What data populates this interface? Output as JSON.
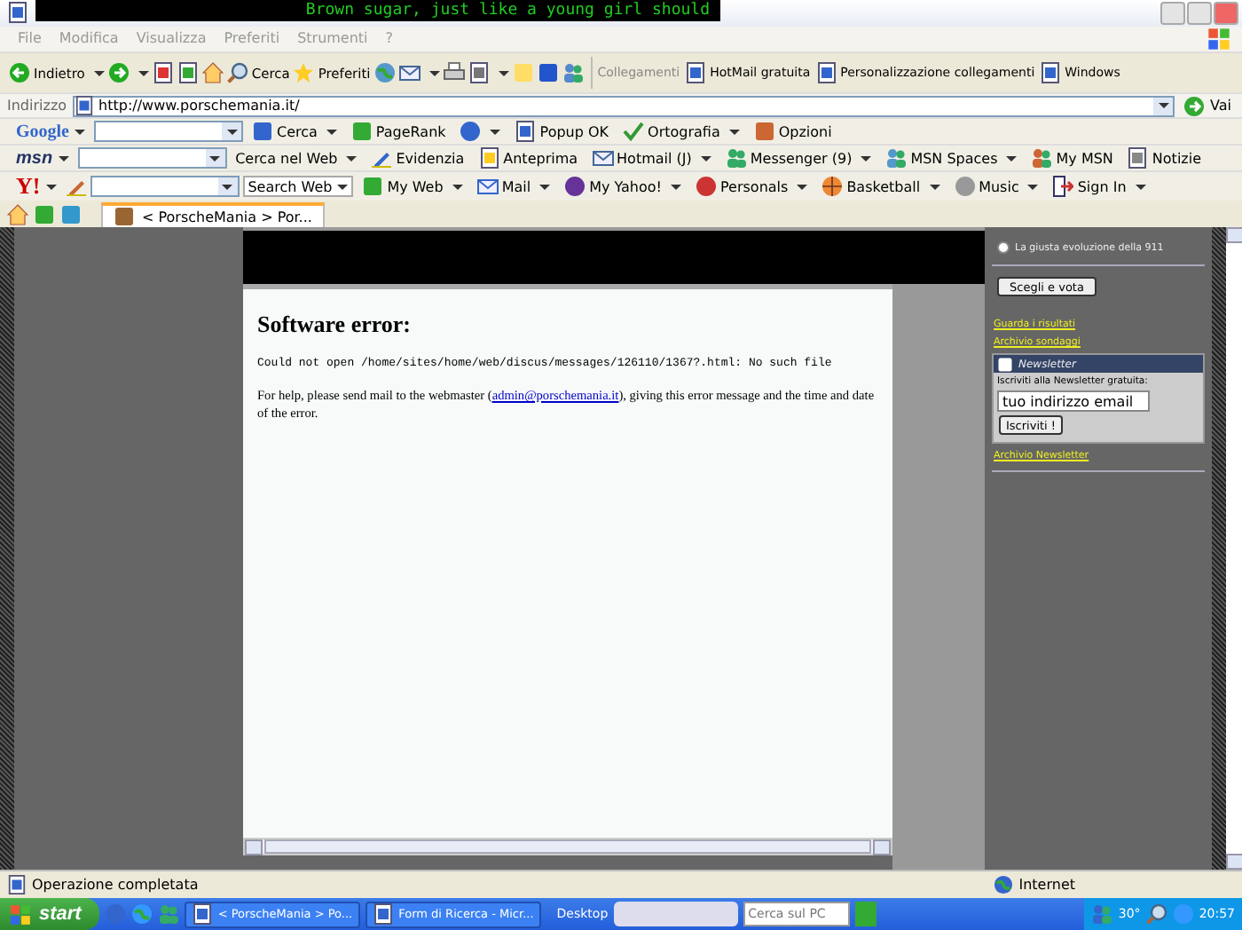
{
  "window": {
    "title": "Brown sugar, just like a young girl should"
  },
  "menu": [
    "File",
    "Modifica",
    "Visualizza",
    "Preferiti",
    "Strumenti",
    "?"
  ],
  "toolbar": [
    {
      "label": "Indietro",
      "dropdown": true
    },
    {
      "dropdown": true
    },
    {
      "dropdown": false
    },
    {
      "dropdown": false
    },
    {
      "dropdown": false
    },
    {
      "label": "Cerca",
      "dropdown": false
    },
    {
      "label": "Preferiti",
      "dropdown": false
    },
    {
      "dropdown": false
    },
    {
      "dropdown": true
    },
    {
      "dropdown": false
    },
    {
      "dropdown": true
    },
    {
      "dropdown": false
    },
    {
      "dropdown": false
    },
    {
      "dropdown": false
    }
  ],
  "links": {
    "label": "Collegamenti",
    "items": [
      "HotMail gratuita",
      "Personalizzazione collegamenti",
      "Windows"
    ]
  },
  "address": {
    "label": "Indirizzo",
    "value": "http://www.porschemania.it/",
    "go": "Vai"
  },
  "google_bar": {
    "logo": "Google",
    "buttons": [
      {
        "label": "Cerca",
        "dropdown": true
      },
      {
        "label": "PageRank",
        "dropdown": false
      },
      {
        "dropdown": true
      },
      {
        "label": "Popup OK",
        "dropdown": false
      },
      {
        "label": "Ortografia",
        "dropdown": true
      },
      {
        "label": "Opzioni",
        "dropdown": false
      }
    ]
  },
  "msn_bar": {
    "logo": "msn",
    "buttons": [
      {
        "label": "Cerca nel Web",
        "dropdown": true
      },
      {
        "label": "Evidenzia",
        "dropdown": false
      },
      {
        "label": "Anteprima",
        "dropdown": false
      },
      {
        "label": "Hotmail (J)",
        "dropdown": true
      },
      {
        "label": "Messenger (9)",
        "dropdown": true
      },
      {
        "label": "MSN Spaces",
        "dropdown": true
      },
      {
        "label": "My MSN",
        "dropdown": false
      },
      {
        "label": "Notizie",
        "dropdown": false
      }
    ]
  },
  "yahoo_bar": {
    "logo": "Y!",
    "search": "Search Web",
    "buttons": [
      {
        "label": "My Web",
        "dropdown": true
      },
      {
        "label": "Mail",
        "dropdown": true
      },
      {
        "label": "My Yahoo!",
        "dropdown": true
      },
      {
        "label": "Personals",
        "dropdown": true
      },
      {
        "label": "Basketball",
        "dropdown": true
      },
      {
        "label": "Music",
        "dropdown": true
      },
      {
        "label": "Sign In",
        "dropdown": true
      }
    ]
  },
  "tabs": [
    {
      "label": "< PorscheMania > Por...",
      "selected": true
    }
  ],
  "error_page": {
    "title": "Software error:",
    "message": "Could not open /home/sites/home/web/discus/messages/126110/1367?.html: No such file",
    "help_before": "For help, please send mail to the webmaster (",
    "link": "admin@porschemania.it",
    "help_after": "), giving this error message and the time and date of the error."
  },
  "sidebar": {
    "poll_option": {
      "label": "La giusta evoluzione della 911",
      "selected": false
    },
    "vote_button": "Scegli e vota",
    "links": [
      "Guarda i risultati",
      "Archivio sondaggi"
    ],
    "newsletter": {
      "title": "Newsletter",
      "prompt": "Iscriviti alla Newsletter gratuita:",
      "email": "tuo indirizzo email",
      "button": "Iscriviti !",
      "archive": "Archivio Newsletter"
    }
  },
  "status_bar": {
    "text": "Operazione completata",
    "zone": "Internet"
  },
  "taskbar": {
    "start": "start",
    "windows": [
      {
        "label": "< PorscheMania > Po...",
        "selected": false
      },
      {
        "label": "Form di Ricerca - Micr...",
        "selected": false
      }
    ],
    "desktop": "Desktop",
    "search_placeholder": "Cerca sul PC",
    "temperature": "30°",
    "clock": "20:57"
  }
}
